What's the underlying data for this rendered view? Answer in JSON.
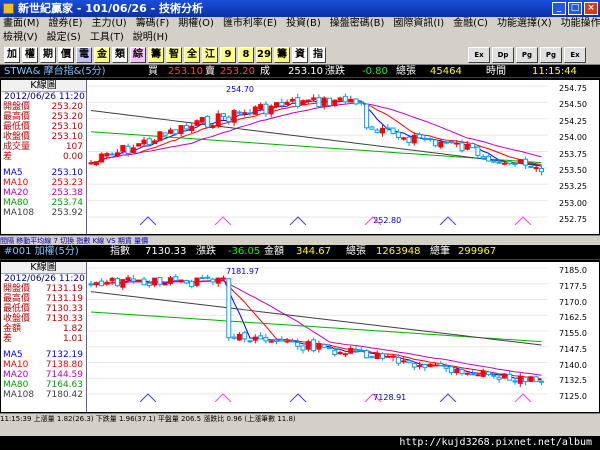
{
  "window": {
    "title": "新世紀贏家 - 101/06/26 - 技術分析"
  },
  "menu1": [
    "畫面(M)",
    "證券(E)",
    "主力(U)",
    "籌碼(F)",
    "期權(O)",
    "匯市利率(E)",
    "投資(B)",
    "操盤密碼(B)",
    "國際資訊(I)",
    "金融(C)",
    "功能選擇(X)",
    "功能操作(F)"
  ],
  "menu2": [
    "檢視(V)",
    "設定(S)",
    "工具(T)",
    "說明(H)"
  ],
  "toolbar": [
    "加",
    "權",
    "期",
    "價",
    "電",
    "金",
    "類",
    "綜",
    "籌",
    "智",
    "全",
    "江",
    "9",
    "8",
    "29",
    "籌",
    "資",
    "指"
  ],
  "top": {
    "ticker": {
      "symbol": "STWA& 摩台指&(5分)",
      "buy_label": "買",
      "buy": "253.10",
      "sell_label": "賣",
      "sell": "253.20",
      "deal_label": "成",
      "deal": "253.10",
      "chg_label": "漲跌",
      "chg": "-0.80",
      "vol_label": "總張",
      "vol": "45464",
      "time_label": "時間",
      "time": "11:15:44"
    },
    "side": {
      "title": "K線圖",
      "date": "2012/06/26 11:20",
      "rows": [
        [
          "開盤價",
          "253.20"
        ],
        [
          "最高價",
          "253.20"
        ],
        [
          "最低價",
          "253.10"
        ],
        [
          "收盤價",
          "253.10"
        ],
        [
          "成交量",
          "107"
        ],
        [
          "差",
          "0.00"
        ]
      ],
      "ma": [
        [
          "MA5",
          "253.10"
        ],
        [
          "MA10",
          "253.23"
        ],
        [
          "MA20",
          "253.38"
        ],
        [
          "MA80",
          "253.74"
        ],
        [
          "MA108",
          "253.92"
        ]
      ]
    },
    "yticks": [
      "254.75",
      "254.50",
      "254.25",
      "254.00",
      "253.75",
      "253.50",
      "253.25",
      "253.00",
      "252.75"
    ],
    "labels": {
      "high": "254.70",
      "low": "252.80",
      "xtick": "26"
    },
    "bottom": "間隔 移動平均線 7 切換 指數 K線 VS 期貨 量價"
  },
  "bot": {
    "ticker": {
      "symbol": "#001 加權(5分)",
      "idx_label": "指數",
      "idx": "7130.33",
      "chg_label": "漲跌",
      "chg": "-36.05",
      "amt_label": "金額",
      "amt": "344.67",
      "vol_label": "總張",
      "vol": "1263948",
      "cnt_label": "總筆",
      "cnt": "299967"
    },
    "side": {
      "title": "K線圖",
      "date": "2012/06/26 11:20",
      "rows": [
        [
          "開盤價",
          "7131.19"
        ],
        [
          "最高價",
          "7131.19"
        ],
        [
          "最低價",
          "7130.33"
        ],
        [
          "收盤價",
          "7130.33"
        ],
        [
          "金額",
          "1.82"
        ],
        [
          "差",
          "1.01"
        ]
      ],
      "ma": [
        [
          "MA5",
          "7132.19"
        ],
        [
          "MA10",
          "7138.80"
        ],
        [
          "MA20",
          "7144.59"
        ],
        [
          "MA80",
          "7164.63"
        ],
        [
          "MA108",
          "7180.42"
        ]
      ]
    },
    "yticks": [
      "7185.0",
      "7177.5",
      "7170.0",
      "7162.5",
      "7155.0",
      "7147.5",
      "7140.0",
      "7132.5",
      "7125.0"
    ],
    "labels": {
      "high": "7181.97",
      "low": "7128.91",
      "xtick": "26"
    },
    "bottom": "11:15:39 上漲量 1.82(26.3) 下跌量 1.96(37.1) 平盤量 206.5 漲跌比 0.96 (上漲筆數 11.8)"
  },
  "status": "http://kujd3268.pixnet.net/album"
}
